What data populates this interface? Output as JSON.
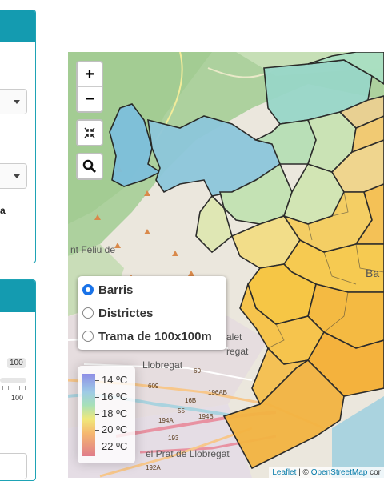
{
  "sidebar": {
    "panel1_text": "a",
    "range_max_badge": "100",
    "range_max_tick": "100"
  },
  "map": {
    "zoom_in": "+",
    "zoom_out": "−",
    "layers": [
      {
        "label": "Barris",
        "selected": true
      },
      {
        "label": "Districtes",
        "selected": false
      },
      {
        "label": "Trama de 100x100m",
        "selected": false
      }
    ],
    "legend": {
      "entries": [
        "14 ºC",
        "16 ºC",
        "18 ºC",
        "20 ºC",
        "22 ºC"
      ],
      "colors": [
        "#8e8ee6",
        "#9ecbe6",
        "#a7e0b8",
        "#f0e87a",
        "#f5b870",
        "#e07c8a"
      ]
    },
    "place_labels": {
      "feliu": "nt Feliu de",
      "hospitalet": "alet",
      "llobregat1": "regat",
      "llobregat2": "Llobregat",
      "prat": "el Prat de Llobregat",
      "ba": "Ba"
    },
    "road_labels": [
      "609",
      "16B",
      "55",
      "194B",
      "196AB",
      "194A",
      "193",
      "192A",
      "60"
    ],
    "attribution": {
      "leaflet": "Leaflet",
      "sep": " | © ",
      "osm": "OpenStreetMap",
      "suffix": " cor"
    }
  }
}
